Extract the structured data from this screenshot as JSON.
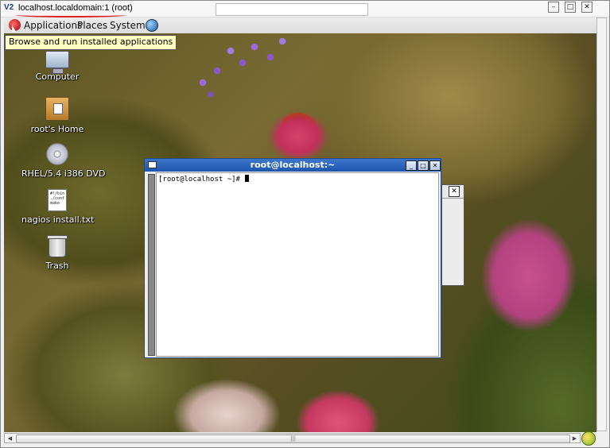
{
  "viewer": {
    "icon_text": "V2",
    "title": "localhost.localdomain:1 (root)",
    "buttons": {
      "minimize": "–",
      "maximize": "□",
      "close": "✕"
    }
  },
  "panel": {
    "menus": [
      "Applications",
      "Places",
      "System"
    ],
    "tooltip": "Browse and run installed applications"
  },
  "desktop": {
    "icons": [
      {
        "label": "Computer"
      },
      {
        "label": "root's Home"
      },
      {
        "label": "RHEL/5.4 i386 DVD",
        "badge": "DVD-ROM"
      },
      {
        "label": "nagios install.txt",
        "preview": "#!/bin\n./conf\nmake"
      },
      {
        "label": "Trash"
      }
    ]
  },
  "terminal": {
    "title": "root@localhost:~",
    "prompt": "[root@localhost ~]# ",
    "buttons": {
      "minimize": "_",
      "maximize": "□",
      "close": "✕"
    }
  },
  "back_terminal": {
    "close": "✕"
  },
  "scrollbar": {
    "grip": "|||"
  }
}
